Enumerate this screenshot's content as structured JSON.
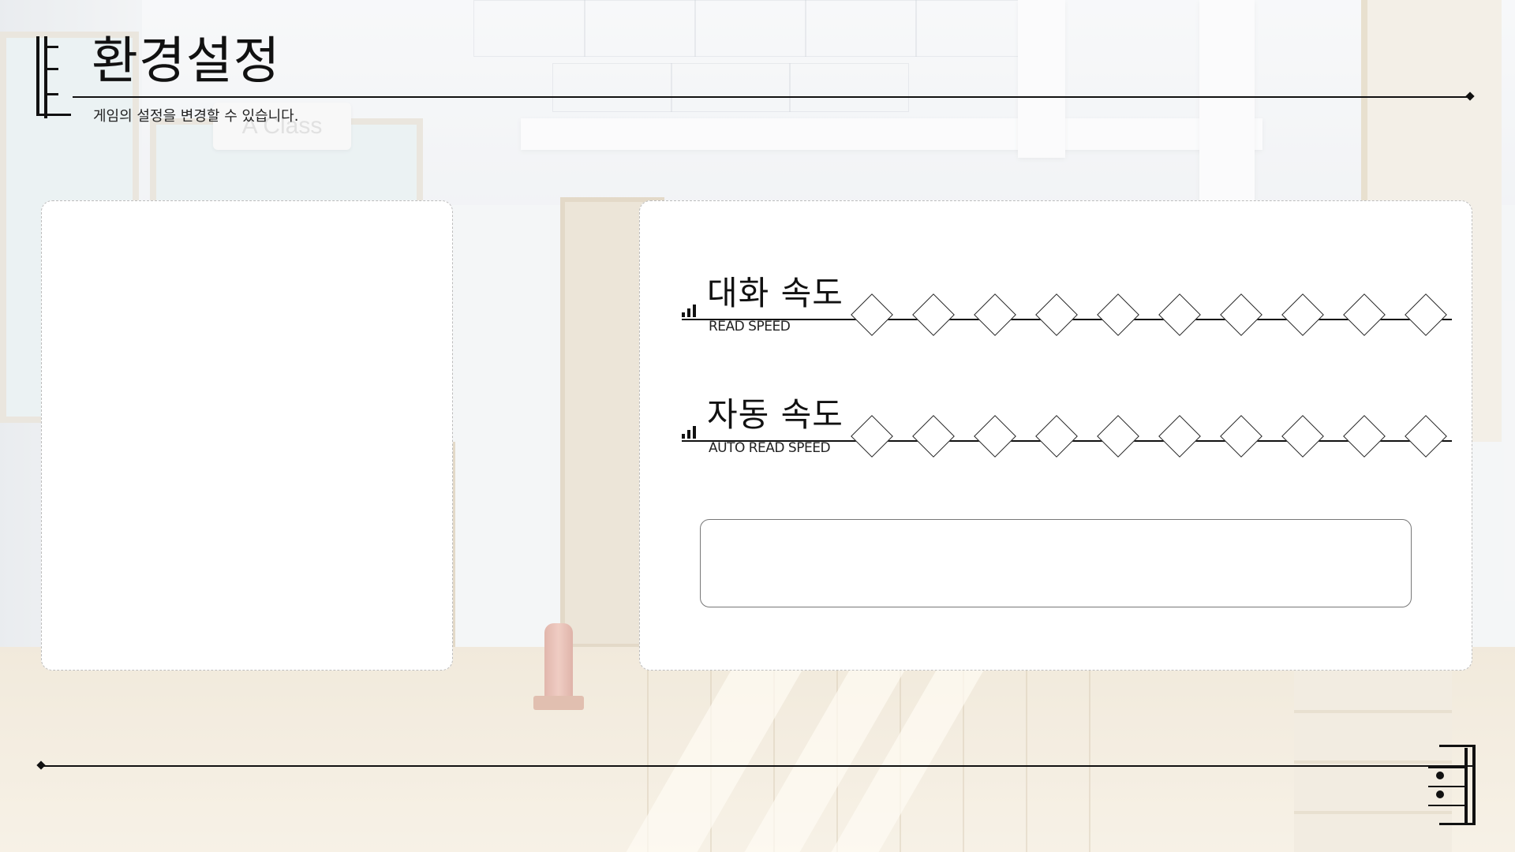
{
  "header": {
    "title": "환경설정",
    "subtitle": "게임의 설정을 변경할 수 있습니다."
  },
  "background": {
    "sign_text": "A Class"
  },
  "settings": [
    {
      "label": "대화 속도",
      "sublabel": "READ SPEED",
      "steps": 10,
      "value": 0
    },
    {
      "label": "자동 속도",
      "sublabel": "AUTO READ SPEED",
      "steps": 10,
      "value": 0
    }
  ],
  "colors": {
    "accent": "#111111",
    "panel": "#ffffff",
    "panel_border": "#bdbdbd"
  }
}
